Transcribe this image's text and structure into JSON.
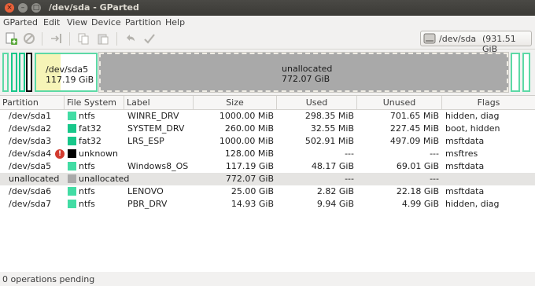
{
  "window": {
    "title": "/dev/sda - GParted"
  },
  "menu": [
    "GParted",
    "Edit",
    "View",
    "Device",
    "Partition",
    "Help"
  ],
  "toolbar": {
    "device": "/dev/sda",
    "device_size": "(931.51 GiB"
  },
  "graph": {
    "sda5_name": "/dev/sda5",
    "sda5_size": "117.19 GiB",
    "sda5_used_fraction": 0.41,
    "unalloc_name": "unallocated",
    "unalloc_size": "772.07 GiB"
  },
  "columns": [
    "Partition",
    "File System",
    "Label",
    "Size",
    "Used",
    "Unused",
    "Flags"
  ],
  "partitions": [
    {
      "partition": "/dev/sda1",
      "fs": "ntfs",
      "fs_color": "#42dca4",
      "label": "WINRE_DRV",
      "size": "1000.00 MiB",
      "used": "298.35 MiB",
      "unused": "701.65 MiB",
      "flags": "hidden, diag"
    },
    {
      "partition": "/dev/sda2",
      "fs": "fat32",
      "fs_color": "#18c78a",
      "label": "SYSTEM_DRV",
      "size": "260.00 MiB",
      "used": "32.55 MiB",
      "unused": "227.45 MiB",
      "flags": "boot, hidden"
    },
    {
      "partition": "/dev/sda3",
      "fs": "fat32",
      "fs_color": "#18c78a",
      "label": "LRS_ESP",
      "size": "1000.00 MiB",
      "used": "502.91 MiB",
      "unused": "497.09 MiB",
      "flags": "msftdata"
    },
    {
      "partition": "/dev/sda4",
      "fs": "unknown",
      "fs_color": "#000000",
      "label": "",
      "size": "128.00 MiB",
      "used": "---",
      "unused": "---",
      "flags": "msftres"
    },
    {
      "partition": "/dev/sda5",
      "fs": "ntfs",
      "fs_color": "#42dca4",
      "label": "Windows8_OS",
      "size": "117.19 GiB",
      "used": "48.17 GiB",
      "unused": "69.01 GiB",
      "flags": "msftdata"
    },
    {
      "partition": "unallocated",
      "fs": "unallocated",
      "fs_color": "#a9a9a9",
      "label": "",
      "size": "772.07 GiB",
      "used": "---",
      "unused": "---",
      "flags": ""
    },
    {
      "partition": "/dev/sda6",
      "fs": "ntfs",
      "fs_color": "#42dca4",
      "label": "LENOVO",
      "size": "25.00 GiB",
      "used": "2.82 GiB",
      "unused": "22.18 GiB",
      "flags": "msftdata"
    },
    {
      "partition": "/dev/sda7",
      "fs": "ntfs",
      "fs_color": "#42dca4",
      "label": "PBR_DRV",
      "size": "14.93 GiB",
      "used": "9.94 GiB",
      "unused": "4.99 GiB",
      "flags": "hidden, diag"
    }
  ],
  "warning_glyph": "!",
  "status": "0 operations pending"
}
